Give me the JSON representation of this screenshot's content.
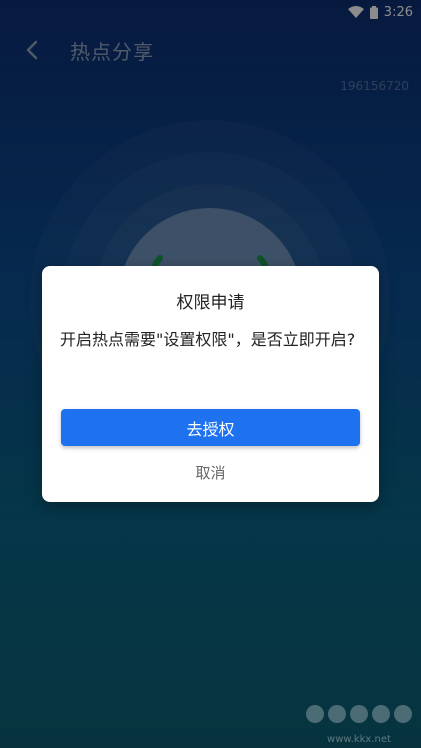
{
  "status_bar": {
    "time": "3:26",
    "icons": [
      "wifi-icon",
      "battery-icon"
    ]
  },
  "app_bar": {
    "back_icon": "chevron-left-icon",
    "title": "热点分享"
  },
  "device_id": "196156720",
  "dialog": {
    "title": "权限申请",
    "message": "开启热点需要\"设置权限\"，是否立即开启?",
    "confirm_label": "去授权",
    "cancel_label": "取消"
  },
  "watermark": {
    "text": "www.kkx.net"
  },
  "colors": {
    "accent": "#1e72f0",
    "background_top": "#0d2f74",
    "background_bottom": "#0b5e72"
  }
}
